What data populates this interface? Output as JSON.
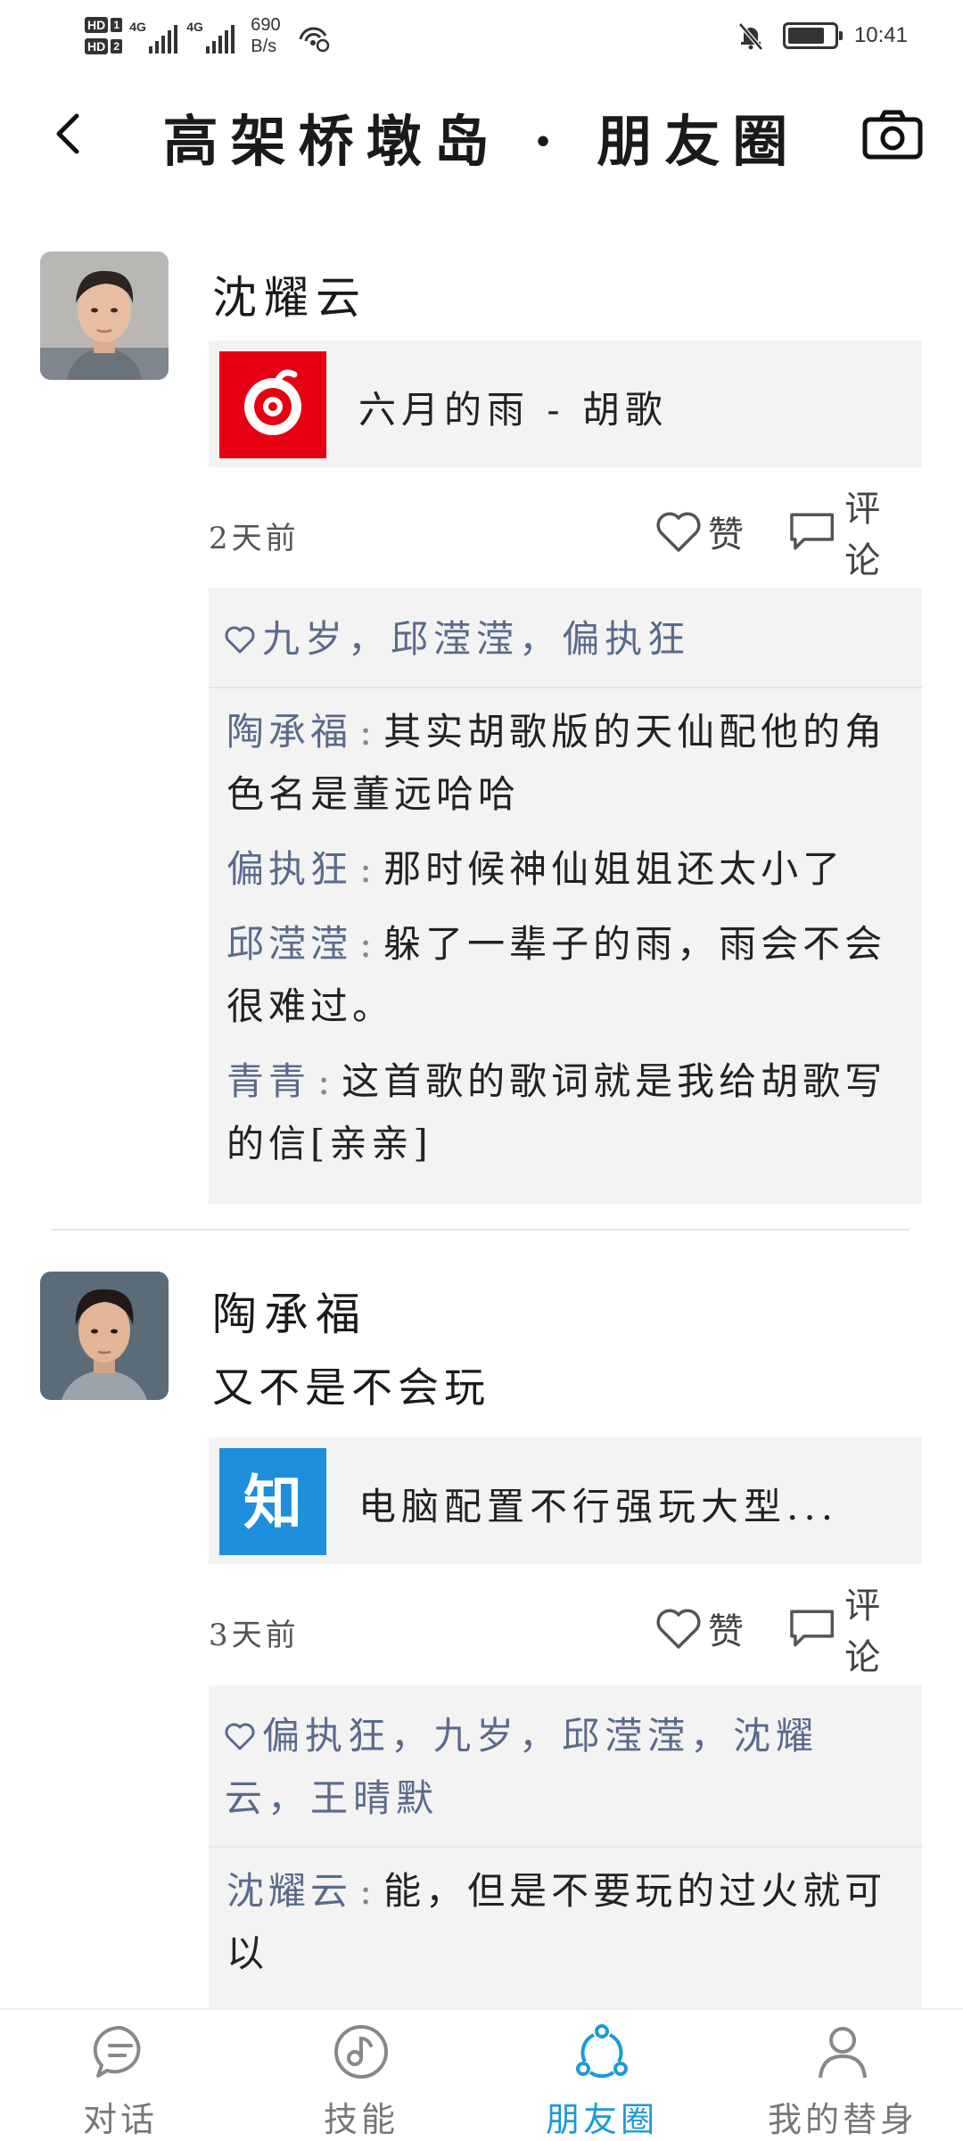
{
  "status_bar": {
    "hd1": "HD",
    "hd1_num": "1",
    "hd2": "HD",
    "hd2_num": "2",
    "net1": "4G",
    "net2": "4G",
    "rate_value": "690",
    "rate_unit": "B/s",
    "time": "10:41",
    "battery_level": 0.8,
    "icons": [
      "wifi-hotspot-icon",
      "mute-bell-icon",
      "battery-icon"
    ]
  },
  "header": {
    "title": "高架桥墩岛 · 朋友圈",
    "back_icon": "chevron-left-icon",
    "camera_icon": "camera-icon"
  },
  "posts": [
    {
      "author": "沈耀云",
      "text": "",
      "share": {
        "icon": "netease-music-icon",
        "icon_color": "#e60012",
        "title": "六月的雨 - 胡歌"
      },
      "time_ago": "2天前",
      "like_label": "赞",
      "comment_label": "评论",
      "likes": [
        "九岁",
        "邱滢滢",
        "偏执狂"
      ],
      "comments": [
        {
          "name": "陶承福",
          "text": "其实胡歌版的天仙配他的角色名是董远哈哈"
        },
        {
          "name": "偏执狂",
          "text": "那时候神仙姐姐还太小了"
        },
        {
          "name": "邱滢滢",
          "text": "躲了一辈子的雨，雨会不会很难过。"
        },
        {
          "name": "青青",
          "text": "这首歌的歌词就是我给胡歌写的信[亲亲]"
        }
      ]
    },
    {
      "author": "陶承福",
      "text": "又不是不会玩",
      "share": {
        "icon": "zhihu-icon",
        "icon_text": "知",
        "icon_color": "#1d8fdb",
        "title": "电脑配置不行强玩大型..."
      },
      "time_ago": "3天前",
      "like_label": "赞",
      "comment_label": "评论",
      "likes": [
        "偏执狂",
        "九岁",
        "邱滢滢",
        "沈耀云",
        "王晴默"
      ],
      "comments": [
        {
          "name": "沈耀云",
          "text": "能，但是不要玩的过火就可以"
        }
      ]
    }
  ],
  "bottom_nav": [
    {
      "label": "对话",
      "icon": "chat-bubble-icon",
      "active": false
    },
    {
      "label": "技能",
      "icon": "skill-disc-icon",
      "active": false
    },
    {
      "label": "朋友圈",
      "icon": "moments-share-icon",
      "active": true
    },
    {
      "label": "我的替身",
      "icon": "profile-person-icon",
      "active": false
    }
  ],
  "colors": {
    "accent": "#1a9ad8",
    "name_link": "#5a6a8c",
    "card_bg": "#f3f3f3"
  }
}
